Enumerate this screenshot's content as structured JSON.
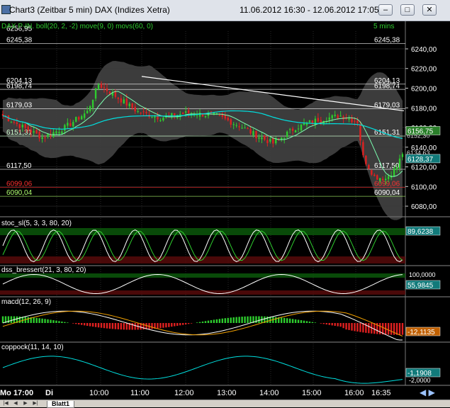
{
  "window": {
    "title": "Chart3 (Zeitbar 5 min)  DAX (Indizes Xetra)",
    "date_range": "11.06.2012 16:30 - 12.06.2012 17:05",
    "buttons": {
      "minimize": "–",
      "maximize": "□",
      "close": "✕"
    }
  },
  "main_panel": {
    "header": "DAX P-IN. boll(20, 2, -2) move(9, 0) movs(60, 0)",
    "interval": "5 mins",
    "y_ticks": [
      6240,
      6220,
      6200,
      6180,
      6160,
      6140,
      6120,
      6100,
      6080
    ],
    "ylim": [
      6075,
      6258
    ],
    "level_labels": [
      "6256,95",
      "6245,38",
      "6204,13",
      "6198,74",
      "6179,03",
      "6151,31",
      "6117,50",
      "6099,06",
      "6090,04"
    ],
    "right_labels": [
      "6245,38",
      "6204,13",
      "6198,74",
      "6179,03",
      "6151,31",
      "6117,50",
      "6099,06",
      "6090,04"
    ],
    "price_badge": "6156,75",
    "price_badge_2": "6128,37",
    "overlap_labels": [
      "6134,63",
      "6152,30"
    ]
  },
  "indicators": [
    {
      "name": "stoc_sl(5, 3, 3, 80, 20)",
      "value": "89,6238",
      "ticks": []
    },
    {
      "name": "dss_bressert(21, 3, 80, 20)",
      "value": "55,9845",
      "ticks": [
        "100,0000"
      ]
    },
    {
      "name": "macd(12, 26, 9)",
      "value": "-12,1135",
      "ticks": []
    },
    {
      "name": "coppock(11, 14, 10)",
      "value": "-1,1908",
      "ticks": [
        "-2,0000"
      ]
    }
  ],
  "time_axis": {
    "labels": [
      "Mo 17:00",
      "Di",
      "10:00",
      "11:00",
      "12:00",
      "13:00",
      "14:00",
      "15:00",
      "16:00",
      "16:35"
    ]
  },
  "sheet_tab": "Blatt1",
  "colors": {
    "background": "#000000",
    "grid": "#3a3a3a",
    "bullish": "#2ecc2e",
    "bearish": "#e02020",
    "ma": "#00e0e0",
    "band": "#6e6e6e",
    "badge_fill": "#2a7f2a"
  }
}
